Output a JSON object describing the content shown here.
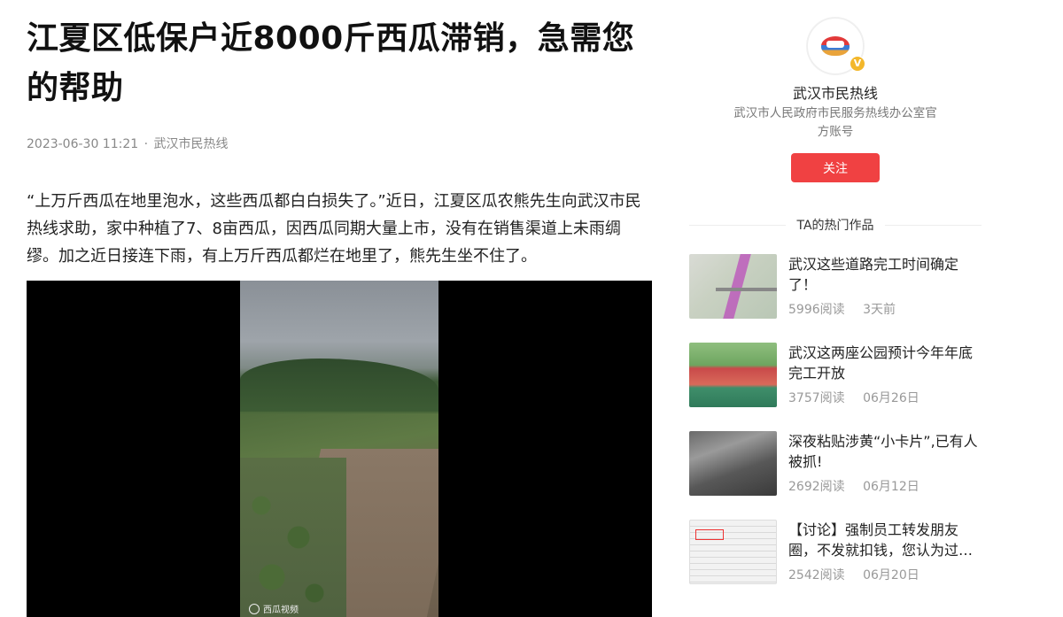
{
  "article": {
    "title": "江夏区低保户近8000斤西瓜滞销，急需您的帮助",
    "date": "2023-06-30 11:21",
    "separator": "·",
    "source": "武汉市民热线",
    "paragraph": "“上万斤西瓜在地里泡水，这些西瓜都白白损失了。”近日，江夏区瓜农熊先生向武汉市民热线求助，家中种植了7、8亩西瓜，因西瓜同期大量上市，没有在销售渠道上未雨绸缪。加之近日接连下雨，有上万斤西瓜都烂在地里了，熊先生坐不住了。",
    "video_watermark": "西瓜视频"
  },
  "sidebar": {
    "author_name": "武汉市民热线",
    "author_desc": "武汉市人民政府市民服务热线办公室官方账号",
    "verified_badge": "V",
    "follow_label": "关注",
    "hot_header": "TA的热门作品",
    "hot_items": [
      {
        "title": "武汉这些道路完工时间确定了！",
        "reads": "5996阅读",
        "time": "3天前"
      },
      {
        "title": "武汉这两座公园预计今年年底完工开放",
        "reads": "3757阅读",
        "time": "06月26日"
      },
      {
        "title": "深夜粘贴涉黄“小卡片”,已有人被抓!",
        "reads": "2692阅读",
        "time": "06月12日"
      },
      {
        "title": "【讨论】强制员工转发朋友圈，不发就扣钱，您认为过…",
        "reads": "2542阅读",
        "time": "06月20日"
      }
    ]
  }
}
